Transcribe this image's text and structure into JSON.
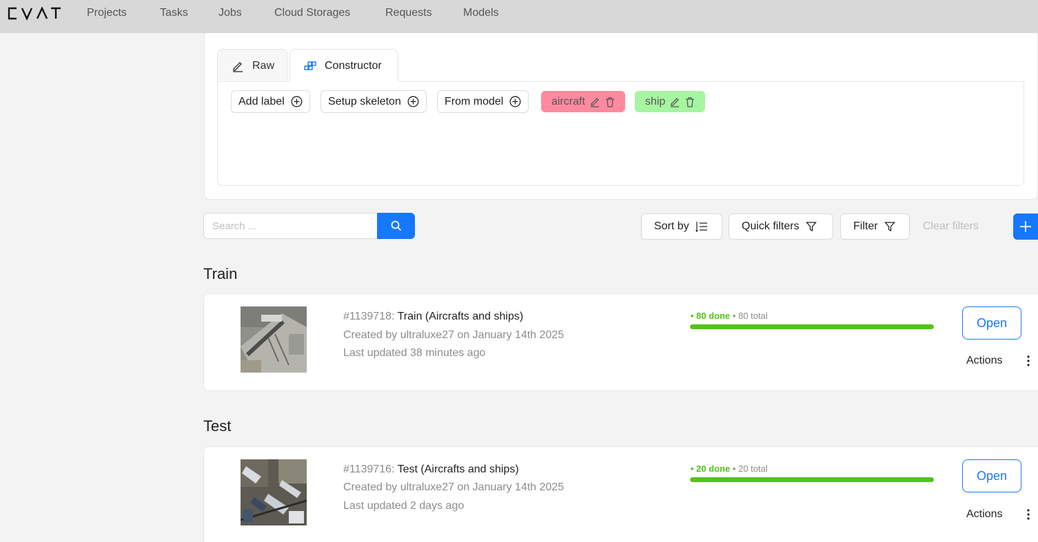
{
  "app": {
    "logo_text": "CVAT",
    "nav": [
      "Projects",
      "Tasks",
      "Jobs",
      "Cloud Storages",
      "Requests",
      "Models"
    ]
  },
  "labels_panel": {
    "tabs": [
      {
        "label": "Raw",
        "icon": "pencil-icon",
        "active": false
      },
      {
        "label": "Constructor",
        "icon": "constructor-blocks-icon",
        "active": true
      }
    ],
    "buttons": [
      {
        "label": "Add label",
        "icon": "plus-circle-icon"
      },
      {
        "label": "Setup skeleton",
        "icon": "plus-circle-icon"
      },
      {
        "label": "From model",
        "icon": "plus-circle-icon"
      }
    ],
    "labels": [
      {
        "name": "aircraft",
        "color": "#ff8aa0"
      },
      {
        "name": "ship",
        "color": "#a6f5a0"
      }
    ]
  },
  "toolbar": {
    "search_placeholder": "Search ...",
    "sort_by": "Sort by",
    "quick_filters": "Quick filters",
    "filter": "Filter",
    "clear_filters": "Clear filters"
  },
  "subsets": [
    {
      "title": "Train",
      "task": {
        "id": "#1139718:",
        "name": "Train (Aircrafts and ships)",
        "created": "Created by ultraluxe27 on January 14th 2025",
        "updated": "Last updated 38 minutes ago",
        "done_text": "• 80 done",
        "total_text": "• 80 total",
        "progress": 1.0,
        "open_label": "Open",
        "actions_label": "Actions"
      }
    },
    {
      "title": "Test",
      "task": {
        "id": "#1139716:",
        "name": "Test (Aircrafts and ships)",
        "created": "Created by ultraluxe27 on January 14th 2025",
        "updated": "Last updated 2 days ago",
        "done_text": "• 20 done",
        "total_text": "• 20 total",
        "progress": 1.0,
        "open_label": "Open",
        "actions_label": "Actions"
      }
    }
  ],
  "colors": {
    "accent": "#1677ff",
    "progress": "#52c41a",
    "topbar": "#d8d8d8"
  }
}
